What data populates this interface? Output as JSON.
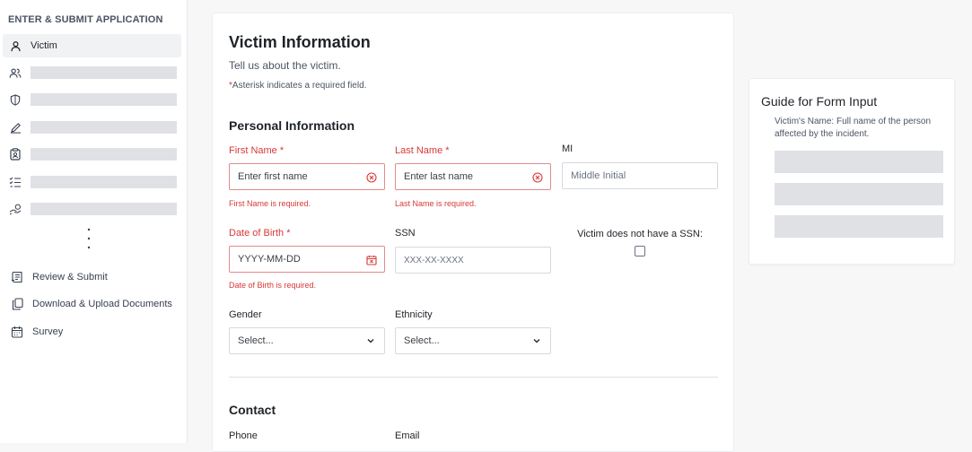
{
  "sidebar": {
    "title": "ENTER & SUBMIT APPLICATION",
    "active_item": {
      "label": "Victim",
      "icon": "person-icon"
    },
    "placeholder_items": [
      {
        "icon": "people-icon"
      },
      {
        "icon": "shield-icon"
      },
      {
        "icon": "pencil-icon"
      },
      {
        "icon": "clipboard-badge-icon"
      },
      {
        "icon": "checklist-icon"
      },
      {
        "icon": "hand-money-icon"
      }
    ],
    "more_indicator": "⋮",
    "links": [
      {
        "label": "Review & Submit",
        "icon": "scroll-icon"
      },
      {
        "label": "Download & Upload Documents",
        "icon": "copy-documents-icon"
      },
      {
        "label": "Survey",
        "icon": "calendar-icon"
      }
    ]
  },
  "form": {
    "title": "Victim Information",
    "subtitle": "Tell us about the victim.",
    "required_star": "*",
    "required_note": "Asterisk indicates a required field.",
    "sections": {
      "personal": "Personal Information",
      "contact": "Contact"
    },
    "fields": {
      "first_name": {
        "label": "First Name *",
        "placeholder": "Enter first name",
        "error": "First Name is required."
      },
      "last_name": {
        "label": "Last Name *",
        "placeholder": "Enter last name",
        "error": "Last Name is required."
      },
      "mi": {
        "label": "MI",
        "placeholder": "Middle Initial"
      },
      "dob": {
        "label": "Date of Birth *",
        "placeholder": "YYYY-MM-DD",
        "error": "Date of Birth is required."
      },
      "ssn": {
        "label": "SSN",
        "placeholder": "XXX-XX-XXXX"
      },
      "no_ssn": {
        "label": "Victim does not have a SSN:",
        "checked": false
      },
      "gender": {
        "label": "Gender",
        "selected": "Select..."
      },
      "ethnicity": {
        "label": "Ethnicity",
        "selected": "Select..."
      },
      "phone": {
        "label": "Phone"
      },
      "email": {
        "label": "Email"
      }
    }
  },
  "guide": {
    "title": "Guide for Form Input",
    "text": "Victim's Name: Full name of the person affected by the incident."
  },
  "colors": {
    "error": "#d93838",
    "error_border": "#e38a8a",
    "placeholder_bar": "#dfe1e5",
    "active_bg": "#f1f2f4"
  }
}
